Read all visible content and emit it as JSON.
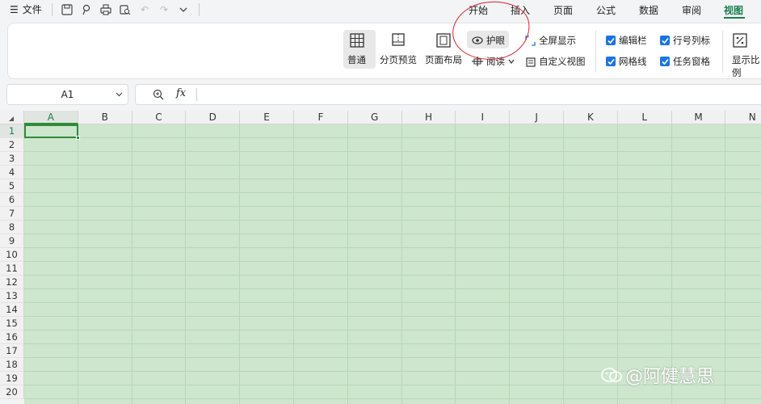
{
  "topbar": {
    "menu_label": "文件",
    "tabs": [
      "开始",
      "插入",
      "页面",
      "公式",
      "数据",
      "审阅",
      "视图"
    ],
    "active_tab": "视图"
  },
  "ribbon": {
    "normal_label": "普通",
    "page_break_label": "分页预览",
    "page_layout_label": "页面布局",
    "eye_protect_label": "护眼",
    "reading_label": "阅读",
    "fullscreen_label": "全屏显示",
    "custom_view_label": "自定义视图",
    "edit_bar_label": "编辑栏",
    "row_col_label": "行号列标",
    "gridlines_label": "网格线",
    "task_pane_label": "任务窗格",
    "zoom_label": "显示比例"
  },
  "formula_bar": {
    "name_box": "A1",
    "fx_label": "fx",
    "content": ""
  },
  "sheet": {
    "columns": [
      "A",
      "B",
      "C",
      "D",
      "E",
      "F",
      "G",
      "H",
      "I",
      "J",
      "K",
      "L",
      "M",
      "N"
    ],
    "rows": [
      "1",
      "2",
      "3",
      "4",
      "5",
      "6",
      "7",
      "8",
      "9",
      "10",
      "11",
      "12",
      "13",
      "14",
      "15",
      "16",
      "17",
      "18",
      "19",
      "20"
    ],
    "selected_cell": "A1",
    "cell_background": "#cde6cd"
  },
  "watermark": {
    "text": "@阿健慧思"
  },
  "colors": {
    "accent": "#1a7f4e",
    "checkbox": "#1a73e8",
    "annotation": "#d8262c"
  }
}
